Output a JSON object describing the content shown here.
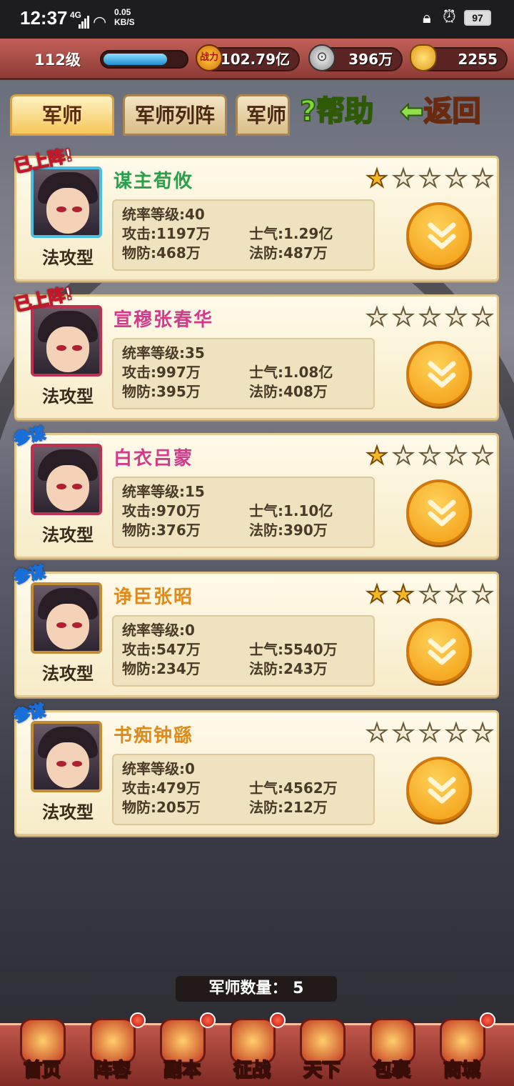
{
  "status_bar": {
    "time": "12:37",
    "network": "4G",
    "speed": "0.05",
    "speed_unit": "KB/S",
    "battery": "97"
  },
  "top_bar": {
    "level": "112级",
    "exp_progress": 0.78,
    "power_label": "战力",
    "power": "102.79亿",
    "silver": "396万",
    "gold": "2255"
  },
  "tabs": [
    {
      "label": "军师"
    },
    {
      "label": "军师列阵"
    },
    {
      "label": "军师"
    }
  ],
  "actions": {
    "help": "帮助",
    "help_mark": "?",
    "back": "返回"
  },
  "advisors": [
    {
      "badge": "已上阵!",
      "badge_style": "red",
      "name": "谋主荀攸",
      "name_color": "#2aa04a",
      "stars": 1,
      "type": "法攻型",
      "command_label": "统率等级:40",
      "attack_label": "攻击:",
      "attack": "1197万",
      "morale_label": "士气:",
      "morale": "1.29亿",
      "pdef_label": "物防:",
      "pdef": "468万",
      "mdef_label": "法防:",
      "mdef": "487万",
      "frame": "#4ac0e0"
    },
    {
      "badge": "已上阵!",
      "badge_style": "red",
      "name": "宣穆张春华",
      "name_color": "#d23a8a",
      "stars": 0,
      "type": "法攻型",
      "command_label": "统率等级:35",
      "attack_label": "攻击:",
      "attack": "997万",
      "morale_label": "士气:",
      "morale": "1.08亿",
      "pdef_label": "物防:",
      "pdef": "395万",
      "mdef_label": "法防:",
      "mdef": "408万",
      "frame": "#c03050"
    },
    {
      "badge": "参谋",
      "badge_style": "blue",
      "name": "白衣吕蒙",
      "name_color": "#d23a8a",
      "stars": 1,
      "type": "法攻型",
      "command_label": "统率等级:15",
      "attack_label": "攻击:",
      "attack": "970万",
      "morale_label": "士气:",
      "morale": "1.10亿",
      "pdef_label": "物防:",
      "pdef": "376万",
      "mdef_label": "法防:",
      "mdef": "390万",
      "frame": "#c03050"
    },
    {
      "badge": "参谋",
      "badge_style": "blue",
      "name": "诤臣张昭",
      "name_color": "#e08a1a",
      "stars": 2,
      "type": "法攻型",
      "command_label": "统率等级:0",
      "attack_label": "攻击:",
      "attack": "547万",
      "morale_label": "士气:",
      "morale": "5540万",
      "pdef_label": "物防:",
      "pdef": "234万",
      "mdef_label": "法防:",
      "mdef": "243万",
      "frame": "#c28b34"
    },
    {
      "badge": "参谋",
      "badge_style": "blue",
      "name": "书痴钟繇",
      "name_color": "#e08a1a",
      "stars": 0,
      "type": "法攻型",
      "command_label": "统率等级:0",
      "attack_label": "攻击:",
      "attack": "479万",
      "morale_label": "士气:",
      "morale": "4562万",
      "pdef_label": "物防:",
      "pdef": "205万",
      "mdef_label": "法防:",
      "mdef": "212万",
      "frame": "#c28b34"
    }
  ],
  "advisor_count": "军师数量： 5",
  "bottom_nav": [
    {
      "label": "首页",
      "icon": "palace-icon",
      "dot": false
    },
    {
      "label": "阵容",
      "icon": "banner-icon",
      "dot": true
    },
    {
      "label": "副本",
      "icon": "sword-icon",
      "dot": true
    },
    {
      "label": "征战",
      "icon": "target-icon",
      "dot": true
    },
    {
      "label": "天下",
      "icon": "scroll-icon",
      "dot": false
    },
    {
      "label": "包裹",
      "icon": "bag-icon",
      "dot": false
    },
    {
      "label": "商城",
      "icon": "shop-icon",
      "dot": true
    }
  ]
}
